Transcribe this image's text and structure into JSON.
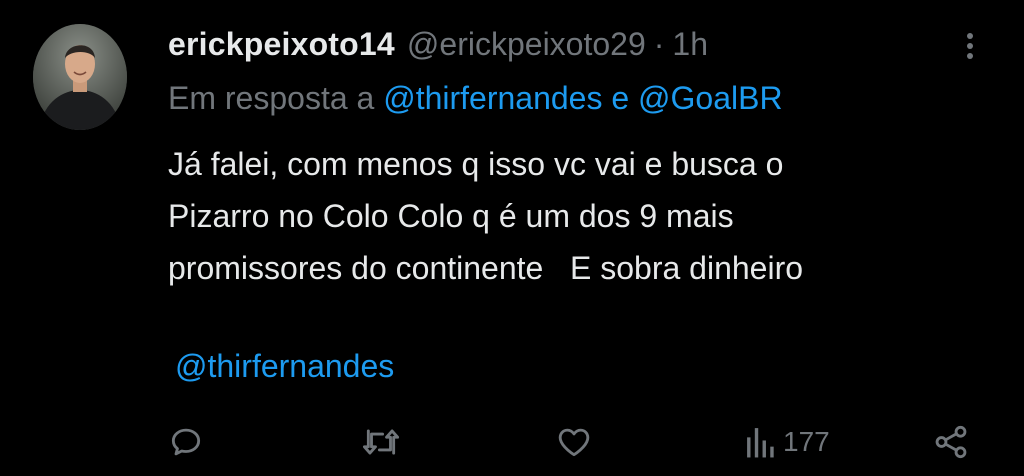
{
  "tweet": {
    "username": "erickpeixoto14",
    "handle": "@erickpeixoto29",
    "separator": "·",
    "time": "1h",
    "reply_prefix": "Em resposta a ",
    "reply_to_1": "@thirfernandes",
    "reply_joiner": " e ",
    "reply_to_2": "@GoalBR",
    "body_lines": [
      "Já falei, com menos q isso vc vai e busca o",
      "Pizarro no Colo Colo q é um dos 9 mais",
      "promissores do continente   E sobra dinheiro"
    ],
    "tagged_mention": "@thirfernandes"
  },
  "actions": {
    "reply_icon": "reply-icon",
    "retweet_icon": "retweet-icon",
    "like_icon": "heart-icon",
    "views_icon": "views-chart-icon",
    "views_count": "177",
    "share_icon": "share-icon",
    "more_icon": "more-options-icon"
  },
  "colors": {
    "background": "#000000",
    "text": "#e7e9ea",
    "muted": "#71767b",
    "link": "#1d9bf0"
  }
}
